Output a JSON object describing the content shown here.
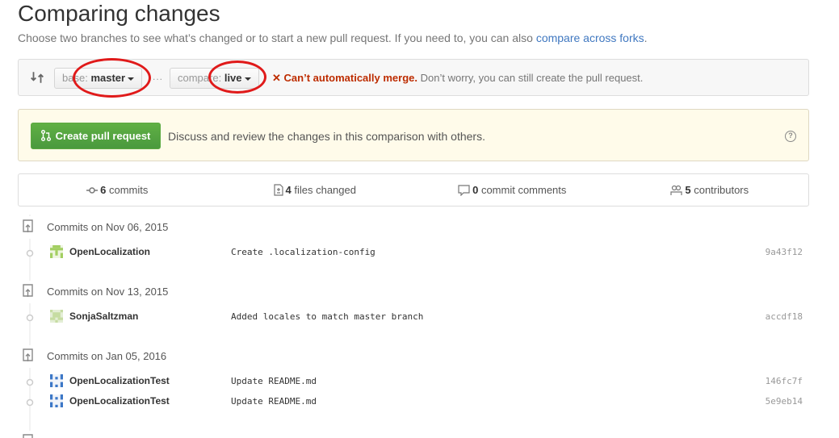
{
  "header": {
    "title": "Comparing changes",
    "subtitle_prefix": "Choose two branches to see what’s changed or to start a new pull request. If you need to, you can also ",
    "subtitle_link": "compare across forks",
    "subtitle_suffix": "."
  },
  "range": {
    "base_label": "base:",
    "base_branch": "master",
    "dots": "...",
    "compare_label": "compare:",
    "compare_branch": "live",
    "merge_icon": "x-icon",
    "merge_warning": "Can’t automatically merge.",
    "merge_note": "Don’t worry, you can still create the pull request."
  },
  "pr_banner": {
    "button_label": "Create pull request",
    "description": "Discuss and review the changes in this comparison with others.",
    "help_glyph": "?"
  },
  "summary": {
    "commits": {
      "count": "6",
      "label": "commits"
    },
    "files": {
      "count": "4",
      "label": "files changed"
    },
    "comments": {
      "count": "0",
      "label": "commit comments"
    },
    "contributors": {
      "count": "5",
      "label": "contributors"
    }
  },
  "commit_groups": [
    {
      "label": "Commits on Nov 06, 2015",
      "commits": [
        {
          "author": "OpenLocalization",
          "message": "Create .localization-config",
          "sha": "9a43f12"
        }
      ]
    },
    {
      "label": "Commits on Nov 13, 2015",
      "commits": [
        {
          "author": "SonjaSaltzman",
          "message": "Added locales to match master branch",
          "sha": "accdf18"
        }
      ]
    },
    {
      "label": "Commits on Jan 05, 2016",
      "commits": [
        {
          "author": "OpenLocalizationTest",
          "message": "Update README.md",
          "sha": "146fc7f"
        },
        {
          "author": "OpenLocalizationTest",
          "message": "Update README.md",
          "sha": "5e9eb14"
        }
      ]
    }
  ],
  "colors": {
    "link": "#4078c0",
    "error": "#bd2c00",
    "button_green": "#55a532",
    "banner_bg": "#fffbea",
    "annotation_red": "#e01a1a"
  }
}
